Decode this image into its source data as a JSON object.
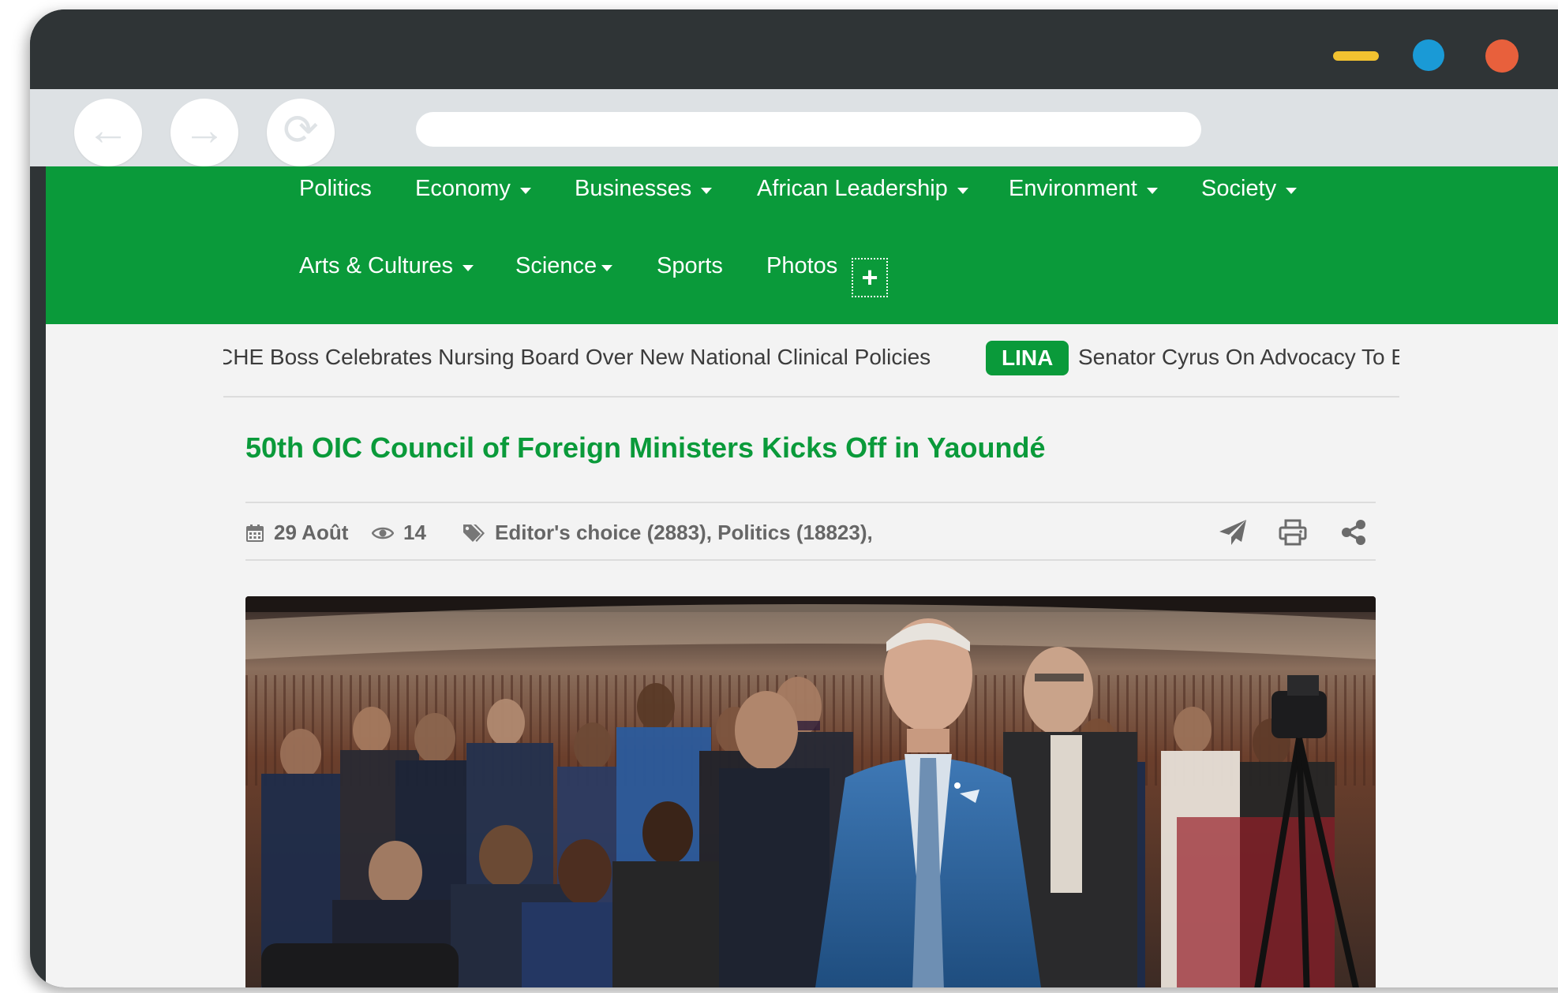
{
  "colors": {
    "accent": "#0a9a3a",
    "window_minimize": "#f2c230",
    "window_maximize": "#1a9ad6",
    "window_close": "#e8603c"
  },
  "browser": {
    "back_icon": "arrow-left-icon",
    "forward_icon": "arrow-right-icon",
    "reload_icon": "reload-icon",
    "address_value": ""
  },
  "nav": {
    "row1": [
      {
        "label": "Politics",
        "dropdown": false
      },
      {
        "label": "Economy",
        "dropdown": true
      },
      {
        "label": "Businesses",
        "dropdown": true
      },
      {
        "label": "African Leadership",
        "dropdown": true
      },
      {
        "label": "Environment",
        "dropdown": true
      },
      {
        "label": "Society",
        "dropdown": true
      }
    ],
    "row2": [
      {
        "label": "Arts & Cultures",
        "dropdown": true
      },
      {
        "label": "Science",
        "dropdown": true
      },
      {
        "label": "Sports",
        "dropdown": false
      },
      {
        "label": "Photos",
        "dropdown": false
      }
    ],
    "more_label": "+"
  },
  "ticker": {
    "item1": "CHE Boss Celebrates Nursing Board Over New National Clinical Policies",
    "badge": "LINA",
    "item2": "Senator Cyrus On Advocacy To E"
  },
  "article": {
    "title": "50th OIC Council of Foreign Ministers Kicks Off in Yaoundé",
    "date": "29 Août",
    "views": "14",
    "tags": "Editor's choice (2883), Politics (18823),",
    "actions": [
      "send-icon",
      "print-icon",
      "share-icon"
    ]
  }
}
